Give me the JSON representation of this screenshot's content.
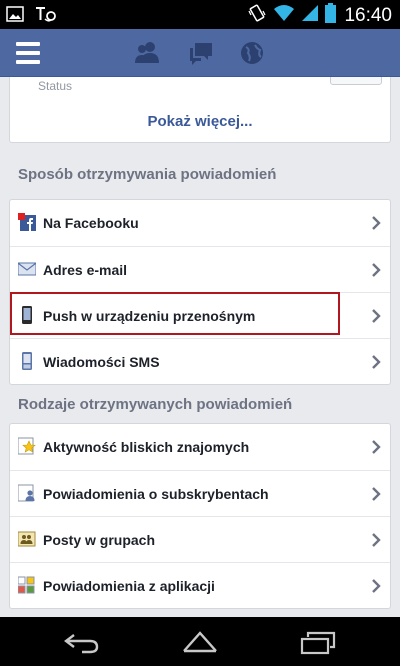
{
  "status_bar": {
    "time": "16:40",
    "left_icons": [
      "image-icon",
      "voicemail-icon"
    ],
    "right_icons": [
      "vibrate-icon",
      "wifi-icon",
      "signal-icon",
      "battery-icon"
    ]
  },
  "header": {
    "icons": [
      "menu-icon",
      "friends-icon",
      "messages-icon",
      "globe-icon"
    ]
  },
  "top_card": {
    "status_label": "Status",
    "show_more": "Pokaż więcej..."
  },
  "section_delivery": {
    "title": "Sposób otrzymywania powiadomień",
    "items": [
      {
        "label": "Na Facebooku",
        "icon": "facebook-icon"
      },
      {
        "label": "Adres e-mail",
        "icon": "email-icon"
      },
      {
        "label": "Push w urządzeniu przenośnym",
        "icon": "mobile-phone-icon"
      },
      {
        "label": "Wiadomości SMS",
        "icon": "sms-phone-icon"
      }
    ]
  },
  "section_types": {
    "title": "Rodzaje otrzymywanych powiadomień",
    "items": [
      {
        "label": "Aktywność bliskich znajomych",
        "icon": "star-icon"
      },
      {
        "label": "Powiadomienia o subskrybentach",
        "icon": "subscribers-icon"
      },
      {
        "label": "Posty w grupach",
        "icon": "groups-icon"
      },
      {
        "label": "Powiadomienia z aplikacji",
        "icon": "apps-icon"
      }
    ]
  },
  "nav_bar": {
    "icons": [
      "back-icon",
      "home-icon",
      "recent-apps-icon"
    ]
  },
  "colors": {
    "header_bg": "#4e69a2",
    "link": "#3b5998",
    "highlight_border": "#b0171f"
  }
}
